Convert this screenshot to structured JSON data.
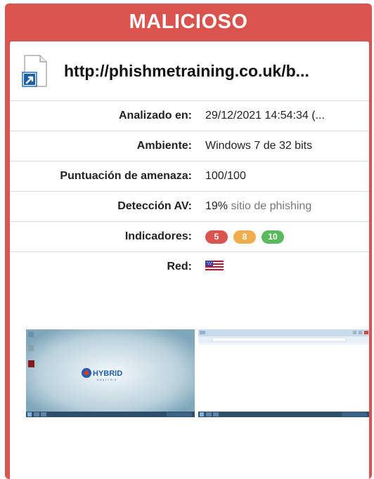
{
  "header": {
    "title": "MALICIOSO",
    "color": "#d9534f"
  },
  "url_row": {
    "icon": "shortcut-file-icon",
    "url": "http://phishmetraining.co.uk/b..."
  },
  "details": [
    {
      "key": "analyzed",
      "label": "Analizado en:",
      "value": "29/12/2021 14:54:34 (..."
    },
    {
      "key": "environment",
      "label": "Ambiente:",
      "value": "Windows 7 de 32 bits"
    },
    {
      "key": "threat_score",
      "label": "Puntuación de amenaza:",
      "value": "100/100"
    },
    {
      "key": "av_detection",
      "label": "Detección AV:",
      "value_pct": "19%",
      "value_desc": "sitio de phishing"
    },
    {
      "key": "indicators",
      "label": "Indicadores:",
      "badges": [
        {
          "count": "5",
          "color": "#d9534f"
        },
        {
          "count": "8",
          "color": "#f0ad4e"
        },
        {
          "count": "10",
          "color": "#5cb85c"
        }
      ]
    },
    {
      "key": "network",
      "label": "Red:",
      "flag_icon": "us-flag-icon"
    }
  ],
  "screenshots": [
    {
      "name": "desktop-screenshot",
      "logo_text": "HYBRID",
      "logo_sub": "ANALYSIS"
    },
    {
      "name": "browser-screenshot"
    }
  ]
}
